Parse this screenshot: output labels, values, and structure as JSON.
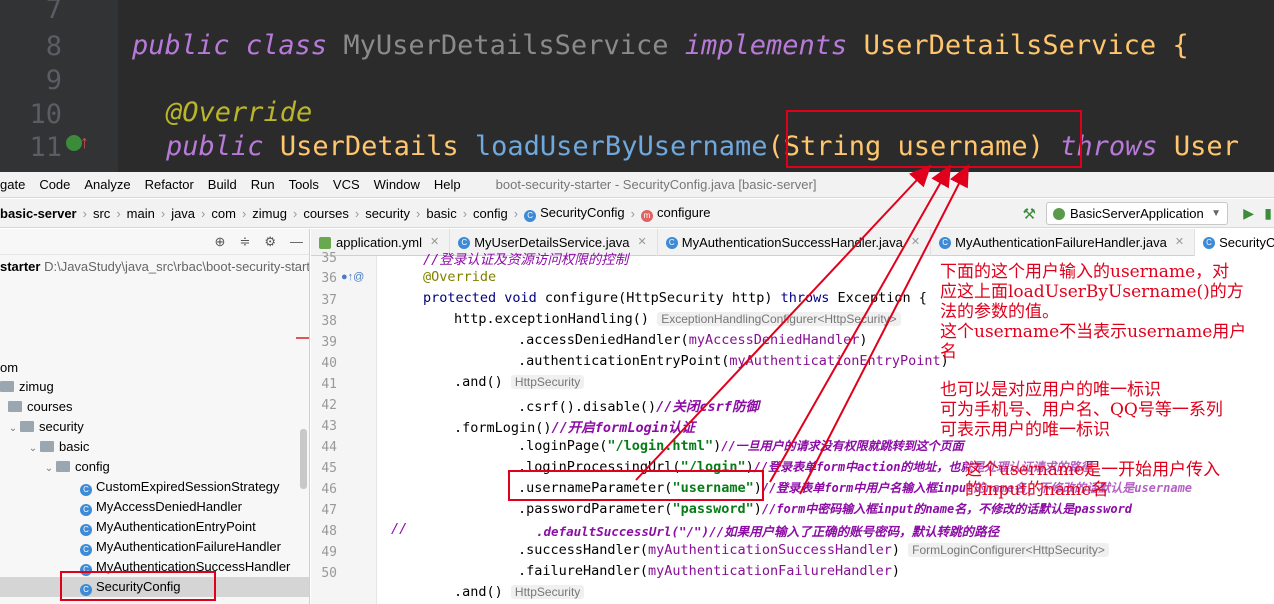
{
  "dark_code": {
    "lines": [
      {
        "num": "7"
      },
      {
        "num": "8",
        "kw1": "public",
        "kw2": "class",
        "cls": "MyUserDetailsService",
        "impl": "implements",
        "iface": "UserDetailsService",
        "brace": "{"
      },
      {
        "num": "9"
      },
      {
        "num": "10",
        "ann": "@Override"
      },
      {
        "num": "11",
        "kw1": "public",
        "type": "UserDetails",
        "method": "loadUserByUsername",
        "params": "(String username)",
        "throws": "throws",
        "rest": "User"
      }
    ]
  },
  "menu": {
    "items": [
      "gate",
      "Code",
      "Analyze",
      "Refactor",
      "Build",
      "Run",
      "Tools",
      "VCS",
      "Window",
      "Help"
    ],
    "window_title": "boot-security-starter - SecurityConfig.java [basic-server]"
  },
  "breadcrumb": {
    "items": [
      "basic-server",
      "src",
      "main",
      "java",
      "com",
      "zimug",
      "courses",
      "security",
      "basic",
      "config",
      "SecurityConfig",
      "configure"
    ],
    "run_config": "BasicServerApplication"
  },
  "project": {
    "root_name": "starter",
    "root_path": "D:\\JavaStudy\\java_src\\rbac\\boot-security-starter",
    "tree": [
      {
        "label": "om"
      },
      {
        "label": "zimug"
      },
      {
        "label": "courses"
      },
      {
        "label": "security"
      },
      {
        "label": "basic"
      },
      {
        "label": "config"
      },
      {
        "label": "CustomExpiredSessionStrategy"
      },
      {
        "label": "MyAccessDeniedHandler"
      },
      {
        "label": "MyAuthenticationEntryPoint"
      },
      {
        "label": "MyAuthenticationFailureHandler"
      },
      {
        "label": "MyAuthenticationSuccessHandler"
      },
      {
        "label": "SecurityConfig"
      }
    ]
  },
  "tabs": [
    {
      "label": "application.yml"
    },
    {
      "label": "MyUserDetailsService.java"
    },
    {
      "label": "MyAuthenticationSuccessHandler.java"
    },
    {
      "label": "MyAuthenticationFailureHandler.java"
    },
    {
      "label": "SecurityConf"
    }
  ],
  "editor": {
    "line_numbers": [
      "35",
      "36",
      "37",
      "38",
      "39",
      "40",
      "41",
      "42",
      "43",
      "44",
      "45",
      "46",
      "47",
      "48",
      "49",
      "50"
    ],
    "l35_comment": "//登录认证及资源访问权限的控制",
    "l36_ann": "@Override",
    "l36_code_a": "protected void ",
    "l36_code_b": "configure(HttpSecurity http) ",
    "l36_code_c": "throws ",
    "l36_code_d": "Exception {",
    "l37_code": "http.exceptionHandling()",
    "l37_hint": "ExceptionHandlingConfigurer<HttpSecurity>",
    "l38_code": ".accessDeniedHandler(",
    "l38_field": "myAccessDeniedHandler",
    "l38_end": ")",
    "l39_code": ".authenticationEntryPoint(",
    "l39_field": "myAuthenticationEntryPoint",
    "l39_end": ")",
    "l40_code": ".and()",
    "l40_hint": "HttpSecurity",
    "l41_code": ".csrf().disable()",
    "l41_comment": "//关闭csrf防御",
    "l42_code": ".formLogin()",
    "l42_comment": "//开启formLogin认证",
    "l43_code": ".loginPage(",
    "l43_str": "\"/login.html\"",
    "l43_end": ")",
    "l43_comment": "//一旦用户的请求没有权限就跳转到这个页面",
    "l44_code": ".loginProcessingUrl(",
    "l44_str": "\"/login\"",
    "l44_end": ")",
    "l44_comment": "//登录表单form中action的地址，也就是处理认证请求的路径",
    "l45_code": ".usernameParameter(",
    "l45_str": "\"username\"",
    "l45_end": ")",
    "l45_comment": "//登录表单form中用户名输入框input的name名，不修改的话默认是username",
    "l46_code": ".passwordParameter(",
    "l46_str": "\"password\"",
    "l46_end": ")",
    "l46_comment": "//form中密码输入框input的name名，不修改的话默认是password",
    "l47_prefix": "//",
    "l47_comment": ".defaultSuccessUrl(\"/\")//如果用户输入了正确的账号密码，默认转跳的路径",
    "l48_code": ".successHandler(",
    "l48_field": "myAuthenticationSuccessHandler",
    "l48_end": ")",
    "l48_hint": "FormLoginConfigurer<HttpSecurity>",
    "l49_code": ".failureHandler(",
    "l49_field": "myAuthenticationFailureHandler",
    "l49_end": ")",
    "l50_code": ".and()",
    "l50_hint": "HttpSecurity"
  },
  "annotations": {
    "note1": [
      "下面的这个用户输入的username，对",
      "应这上面loadUserByUsername()的方",
      "法的参数的值。",
      "这个username不当表示username用户",
      "名"
    ],
    "note2": [
      "也可以是对应用户的唯一标识",
      "可为手机号、用户名、QQ号等一系列",
      "可表示用户的唯一标识"
    ],
    "note3": [
      "这个username是一开始用户传入",
      "的input的name名"
    ],
    "color": "#e0001b"
  }
}
